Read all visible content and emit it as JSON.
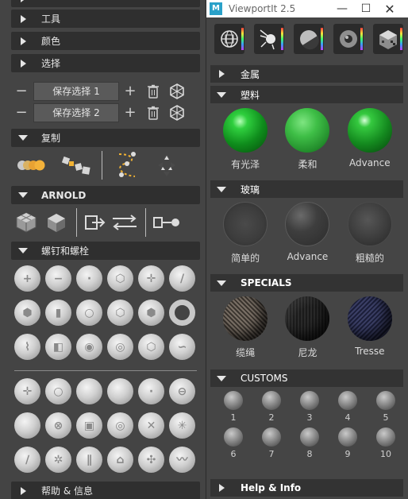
{
  "left_panel": {
    "sections": {
      "top_cut": "",
      "tools": "工具",
      "colors": "颜色",
      "select": "选择",
      "copy": "复制",
      "arnold": "ARNOLD",
      "screws": "螺钉和螺栓",
      "help": "帮助 & 信息"
    },
    "selections": [
      {
        "label": "保存选择 1"
      },
      {
        "label": "保存选择 2"
      }
    ]
  },
  "window": {
    "title": "ViewportIt 2.5",
    "icon_letter": "M"
  },
  "right_panel": {
    "sections": {
      "metal": "金属",
      "plastic": "塑料",
      "glass": "玻璃",
      "specials": "SPECIALS",
      "customs": "CUSTOMS",
      "help": "Help & Info"
    },
    "plastic_items": [
      {
        "label": "有光泽"
      },
      {
        "label": "柔和"
      },
      {
        "label": "Advance"
      }
    ],
    "glass_items": [
      {
        "label": "简单的"
      },
      {
        "label": "Advance"
      },
      {
        "label": "粗糙的"
      }
    ],
    "special_items": [
      {
        "label": "缆绳"
      },
      {
        "label": "尼龙"
      },
      {
        "label": "Tresse"
      }
    ],
    "customs": [
      "1",
      "2",
      "3",
      "4",
      "5",
      "6",
      "7",
      "8",
      "9",
      "10"
    ]
  },
  "colors": {
    "panel_bg": "#444444",
    "header_bg": "#2f2f2f",
    "plastic_green": "#1fa52e",
    "titlebar_bg": "#ffffff"
  }
}
